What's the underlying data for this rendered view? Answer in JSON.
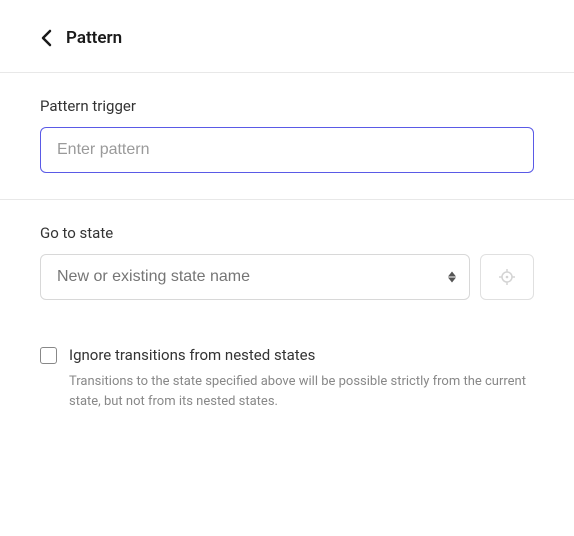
{
  "header": {
    "title": "Pattern"
  },
  "sections": {
    "trigger": {
      "label": "Pattern trigger",
      "placeholder": "Enter pattern",
      "value": ""
    },
    "goto": {
      "label": "Go to state",
      "placeholder": "New or existing state name",
      "value": ""
    }
  },
  "ignore": {
    "label": "Ignore transitions from nested states",
    "checked": false,
    "helper": "Transitions to the state specified above will be possible strictly from the current state, but not from its nested states."
  }
}
